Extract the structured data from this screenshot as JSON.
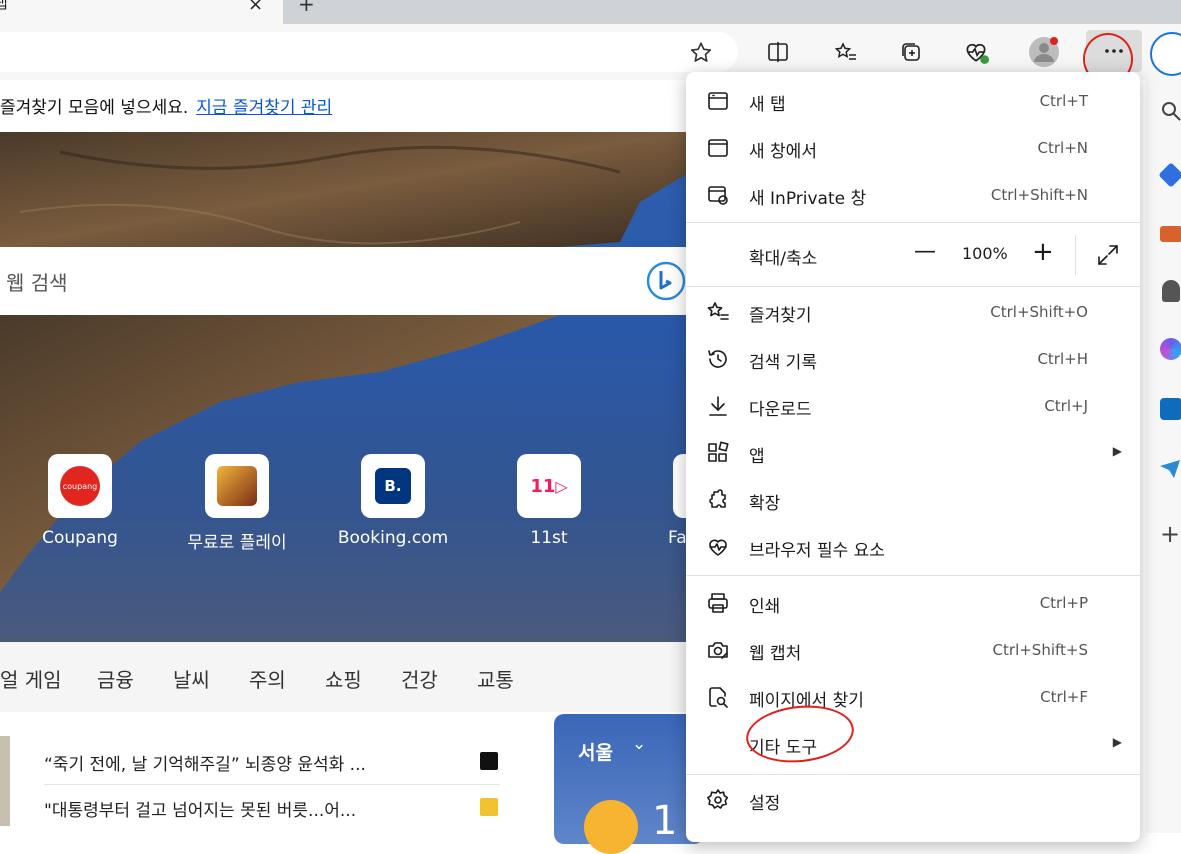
{
  "tab": {
    "title": "탭",
    "close": "×",
    "new_tab": "+"
  },
  "favorites_bar": {
    "text": "즐겨찾기 모음에 넣으세요.",
    "link": "지금 즐겨찾기 관리"
  },
  "search": {
    "placeholder": "웹 검색"
  },
  "tiles": [
    {
      "label": "Coupang"
    },
    {
      "label": "무료로 플레이"
    },
    {
      "label": "Booking.com",
      "glyph": "B."
    },
    {
      "label": "11st",
      "glyph": "11"
    },
    {
      "label": "Fa"
    }
  ],
  "news_nav": [
    "얼 게임",
    "금융",
    "날씨",
    "주의",
    "쇼핑",
    "건강",
    "교통"
  ],
  "news": [
    "“죽기 전에, 날 기억해주길” 뇌종양 윤석화 ...",
    "\"대통령부터 걸고 넘어지는 못된 버릇...어..."
  ],
  "weather": {
    "city": "서울",
    "chevron": "⌄",
    "temp_partial": "1"
  },
  "menu": {
    "items_top": [
      {
        "label": "새 탭",
        "shortcut": "Ctrl+T",
        "icon": "new-tab-icon"
      },
      {
        "label": "새 창에서",
        "shortcut": "Ctrl+N",
        "icon": "new-window-icon"
      },
      {
        "label": "새 InPrivate 창",
        "shortcut": "Ctrl+Shift+N",
        "icon": "inprivate-icon"
      }
    ],
    "zoom": {
      "label": "확대/축소",
      "value": "100%",
      "minus": "—",
      "plus": "+"
    },
    "items_mid": [
      {
        "label": "즐겨찾기",
        "shortcut": "Ctrl+Shift+O",
        "icon": "favorites-icon"
      },
      {
        "label": "검색 기록",
        "shortcut": "Ctrl+H",
        "icon": "history-icon"
      },
      {
        "label": "다운로드",
        "shortcut": "Ctrl+J",
        "icon": "download-icon"
      },
      {
        "label": "앱",
        "shortcut": "",
        "icon": "apps-icon",
        "submenu": true
      },
      {
        "label": "확장",
        "shortcut": "",
        "icon": "extensions-icon"
      },
      {
        "label": "브라우저 필수 요소",
        "shortcut": "",
        "icon": "browser-essentials-icon"
      }
    ],
    "items_tools": [
      {
        "label": "인쇄",
        "shortcut": "Ctrl+P",
        "icon": "print-icon"
      },
      {
        "label": "웹 캡처",
        "shortcut": "Ctrl+Shift+S",
        "icon": "web-capture-icon"
      },
      {
        "label": "페이지에서 찾기",
        "shortcut": "Ctrl+F",
        "icon": "find-icon"
      },
      {
        "label": "기타 도구",
        "shortcut": "",
        "icon": "",
        "submenu": true
      }
    ],
    "settings": {
      "label": "설정",
      "icon": "settings-icon"
    },
    "submenu_arrow": "▶"
  },
  "colors": {
    "annotation_red": "#e0201a",
    "link_blue": "#0b57d0",
    "hero_blue": "#2f5fb0"
  }
}
